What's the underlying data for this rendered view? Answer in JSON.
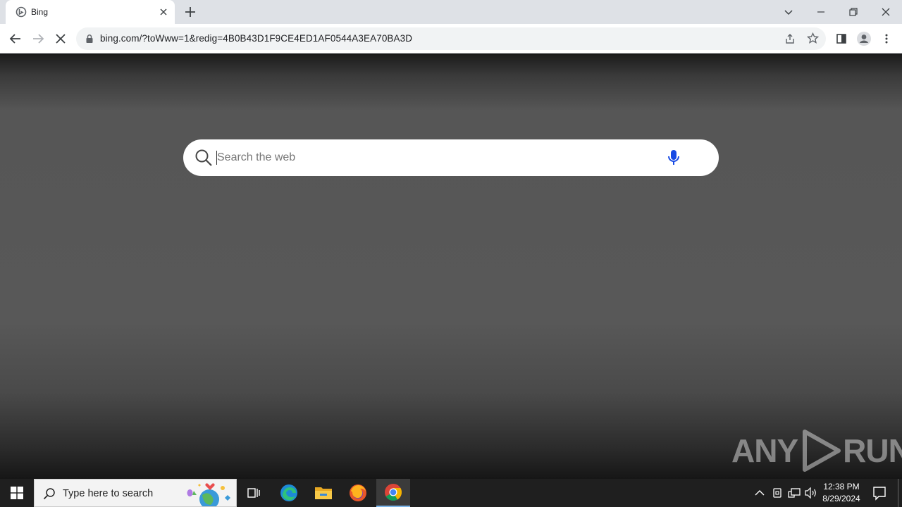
{
  "browser": {
    "tab": {
      "title": "Bing"
    },
    "url": "bing.com/?toWww=1&redig=4B0B43D1F9CE4ED1AF0544A3EA70BA3D"
  },
  "search": {
    "placeholder": "Search the web",
    "value": ""
  },
  "watermark": {
    "left": "ANY",
    "right": "RUN"
  },
  "taskbar": {
    "search_placeholder": "Type here to search",
    "time": "12:38 PM",
    "date": "8/29/2024"
  },
  "colors": {
    "accent_blue": "#174ae4",
    "tab_strip": "#dee1e6",
    "taskbar": "#1f1f1f"
  },
  "icons": [
    "bing-favicon-icon",
    "close-icon",
    "plus-icon",
    "chevron-down-icon",
    "minimize-icon",
    "restore-icon",
    "back-arrow-icon",
    "forward-arrow-icon",
    "stop-loading-icon",
    "lock-icon",
    "share-icon",
    "star-icon",
    "side-panel-icon",
    "profile-icon",
    "more-vert-icon",
    "search-icon",
    "microphone-icon",
    "windows-logo-icon",
    "task-view-icon",
    "edge-icon",
    "file-explorer-icon",
    "firefox-icon",
    "chrome-icon",
    "chevron-up-icon",
    "network-icon",
    "volume-icon",
    "notification-icon"
  ]
}
